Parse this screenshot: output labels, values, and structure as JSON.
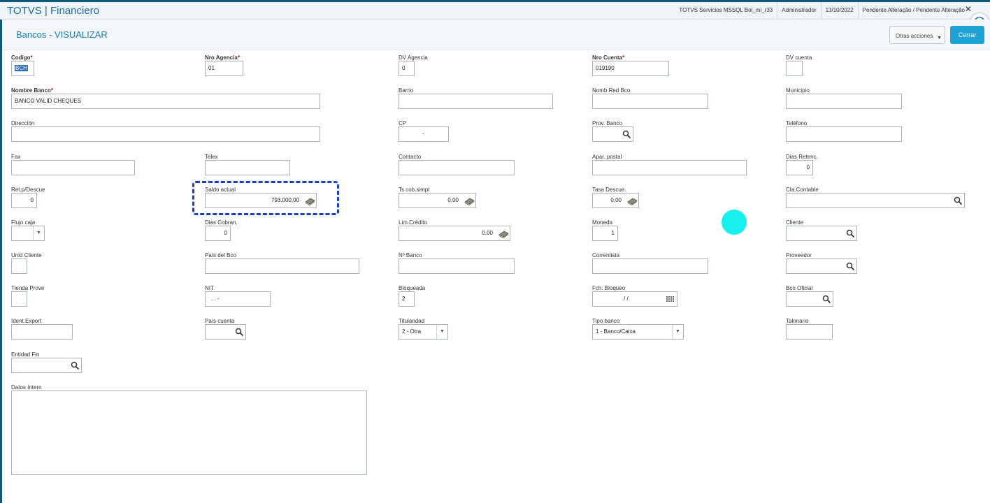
{
  "header": {
    "app_title": "TOTVS | Financiero",
    "environment": "TOTVS Servicios MSSQL Bol_mi_r33",
    "user": "Administrador",
    "date": "13/10/2022",
    "status": "Pendente Alteração / Pendente Alteração",
    "close_label": "✕"
  },
  "page": {
    "title": "Bancos - VISUALIZAR",
    "otras_acciones": "Otras acciones",
    "cerrar": "Cerrar"
  },
  "fields": {
    "codigo": {
      "label": "Codigo",
      "value": "BCH"
    },
    "nro_agencia": {
      "label": "Nro Agencia",
      "value": "01"
    },
    "dv_agencia": {
      "label": "DV Agencia",
      "value": "0"
    },
    "nro_cuenta": {
      "label": "Nro Cuenta",
      "value": "019190"
    },
    "dv_cuenta": {
      "label": "DV cuenta",
      "value": ""
    },
    "nombre_banco": {
      "label": "Nombre Banco",
      "value": "BANCO VALID CHEQUES"
    },
    "barrio": {
      "label": "Barrio",
      "value": ""
    },
    "nomb_red_bco": {
      "label": "Nomb Red Bco",
      "value": ""
    },
    "municipio": {
      "label": "Municipio",
      "value": ""
    },
    "direccion": {
      "label": "Dirección",
      "value": ""
    },
    "cp": {
      "label": "CP",
      "value": "-"
    },
    "prov_banco": {
      "label": "Prov. Banco",
      "value": ""
    },
    "telefono": {
      "label": "Teléfono",
      "value": ""
    },
    "fax": {
      "label": "Fax",
      "value": ""
    },
    "telex": {
      "label": "Telex",
      "value": ""
    },
    "contacto": {
      "label": "Contacto",
      "value": ""
    },
    "apar_postal": {
      "label": "Apar. postal",
      "value": ""
    },
    "dias_retenc": {
      "label": "Dias Retenc.",
      "value": "0"
    },
    "ret_p_descue": {
      "label": "Ret.p/Descue",
      "value": "0"
    },
    "saldo_actual": {
      "label": "Saldo actual",
      "value": "793.000,00"
    },
    "ts_cob_simpl": {
      "label": "Ts cob.simpl",
      "value": "0,00"
    },
    "tasa_descue": {
      "label": "Tasa Descue.",
      "value": "0,00"
    },
    "cta_contable": {
      "label": "Cta.Contable",
      "value": ""
    },
    "flujo_caja": {
      "label": "Flujo caja",
      "value": ""
    },
    "dias_cobran": {
      "label": "Dias Cobran.",
      "value": "0"
    },
    "lim_credito": {
      "label": "Lim.Crédito",
      "value": "0,00"
    },
    "moneda": {
      "label": "Moneda",
      "value": "1"
    },
    "cliente": {
      "label": "Cliente",
      "value": ""
    },
    "unid_cliente": {
      "label": "Unid Cliente",
      "value": ""
    },
    "pais_del_bco": {
      "label": "País del Bco",
      "value": ""
    },
    "n_banco": {
      "label": "Nº Banco",
      "value": ""
    },
    "correntista": {
      "label": "Correntista",
      "value": ""
    },
    "proveedor": {
      "label": "Proveedor",
      "value": ""
    },
    "tienda_prove": {
      "label": "Tienda Prove",
      "value": ""
    },
    "nit": {
      "label": "NIT",
      "value": ". . -"
    },
    "bloqueada": {
      "label": "Bloqueada",
      "value": "2"
    },
    "fch_bloqueo": {
      "label": "Fch. Bloqueo",
      "value": "/ /"
    },
    "bco_oficial": {
      "label": "Bco Oficial",
      "value": ""
    },
    "ident_export": {
      "label": "Ident.Export",
      "value": ""
    },
    "pais_cuenta": {
      "label": "País cuenta",
      "value": ""
    },
    "titularidad": {
      "label": "Titularidad",
      "value": "2 - Otra"
    },
    "tipo_banco": {
      "label": "Tipo banco",
      "value": "1 - Banco/Caixa"
    },
    "talonario": {
      "label": "Talonario",
      "value": ""
    },
    "entidad_fin": {
      "label": "Entidad Fin",
      "value": ""
    },
    "datos_intern": {
      "label": "Datos Intern",
      "value": ""
    }
  },
  "icons": {
    "search": "magnifier-icon",
    "money": "money-icon",
    "calendar": "calendar-icon",
    "dropdown": "chevron-down-icon",
    "chat": "chat-icon"
  },
  "colors": {
    "accent": "#1b7db3",
    "button_primary": "#1fa3d6",
    "highlight_dash": "#1b3bd1",
    "cursor_dot": "#18f0f0",
    "required": "#d0021b"
  }
}
